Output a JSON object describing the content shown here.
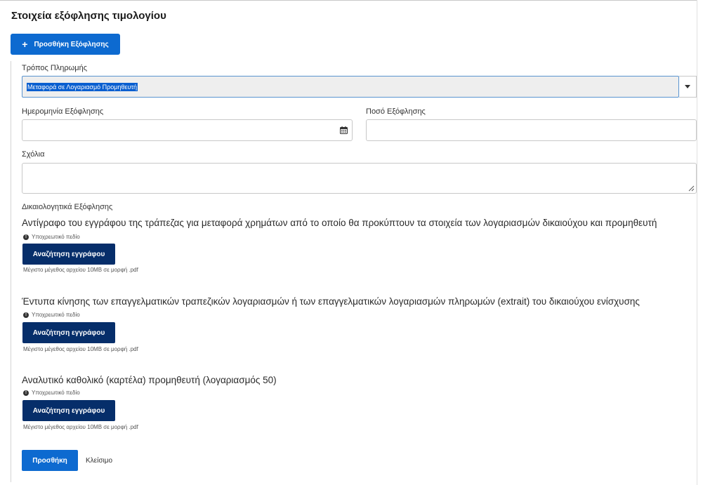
{
  "section": {
    "title": "Στοιχεία εξόφλησης τιμολογίου",
    "add_payment_label": "Προσθήκη Εξόφλησης"
  },
  "form": {
    "payment_method": {
      "label": "Τρόπος Πληρωμής",
      "selected": "Μεταφορά σε Λογαριασμό Προμηθευτή"
    },
    "payment_date": {
      "label": "Ημερομηνία Εξόφλησης",
      "value": ""
    },
    "payment_amount": {
      "label": "Ποσό Εξόφλησης",
      "value": ""
    },
    "comments": {
      "label": "Σχόλια",
      "value": ""
    },
    "documents_label": "Δικαιολογητικά Εξόφλησης",
    "documents": [
      {
        "title": "Αντίγραφο του εγγράφου της τράπεζας για μεταφορά χρημάτων από το οποίο θα προκύπτουν τα στοιχεία των λογαριασμών δικαιούχου και προμηθευτή",
        "required": "Υποχρεωτικό πεδίο",
        "button": "Αναζήτηση εγγράφου",
        "hint": "Μέγιστο μέγεθος αρχείου 10MB σε μορφή .pdf"
      },
      {
        "title": "Έντυπα κίνησης των επαγγελματικών τραπεζικών λογαριασμών ή των επαγγελματικών λογαριασμών πληρωμών (extrait) του δικαιούχου ενίσχυσης",
        "required": "Υποχρεωτικό πεδίο",
        "button": "Αναζήτηση εγγράφου",
        "hint": "Μέγιστο μέγεθος αρχείου 10MB σε μορφή .pdf"
      },
      {
        "title": "Αναλυτικό καθολικό (καρτέλα) προμηθευτή (λογαριασμός 50)",
        "required": "Υποχρεωτικό πεδίο",
        "button": "Αναζήτηση εγγράφου",
        "hint": "Μέγιστο μέγεθος αρχείου 10MB σε μορφή .pdf"
      }
    ]
  },
  "actions": {
    "submit_label": "Προσθήκη",
    "close_label": "Κλείσιμο"
  },
  "icons": {
    "add": "plus-icon",
    "calendar": "calendar-icon",
    "dropdown": "chevron-down-icon",
    "info": "info-icon",
    "resize": "resize-grip-icon"
  },
  "colors": {
    "primary": "#0d6ad0",
    "dark_button": "#062e6a",
    "selection": "#0a5fd0"
  }
}
